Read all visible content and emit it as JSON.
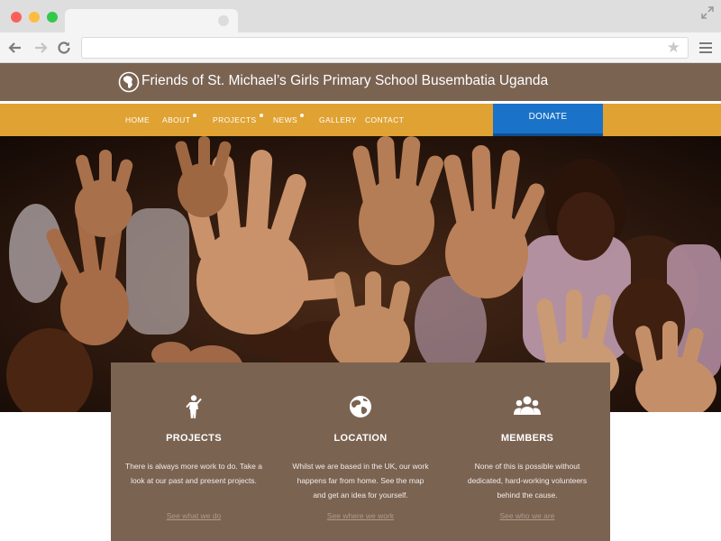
{
  "site": {
    "title": "Friends of St. Michael’s Girls Primary School Busembatia Uganda"
  },
  "nav": {
    "items": [
      {
        "label": "HOME",
        "has_submenu": false
      },
      {
        "label": "ABOUT",
        "has_submenu": true
      },
      {
        "label": "PROJECTS",
        "has_submenu": true
      },
      {
        "label": "NEWS",
        "has_submenu": true
      },
      {
        "label": "GALLERY",
        "has_submenu": false
      },
      {
        "label": "CONTACT",
        "has_submenu": false
      }
    ],
    "donate_label": "DONATE"
  },
  "features": [
    {
      "icon": "child-icon",
      "title": "PROJECTS",
      "text": "There is always more work to do. Take a look at our past and present projects.",
      "link": "See what we do"
    },
    {
      "icon": "globe-icon",
      "title": "LOCATION",
      "text": "Whilst we are based in the UK, our work happens far from home. See the map and get an idea for yourself.",
      "link": "See where we work"
    },
    {
      "icon": "group-icon",
      "title": "MEMBERS",
      "text": "None of this is possible without dedicated, hard-working volunteers behind the cause.",
      "link": "See who we are"
    }
  ],
  "colors": {
    "header_brown": "#7b6352",
    "nav_orange": "#e0a232",
    "donate_blue": "#1a73c8"
  }
}
